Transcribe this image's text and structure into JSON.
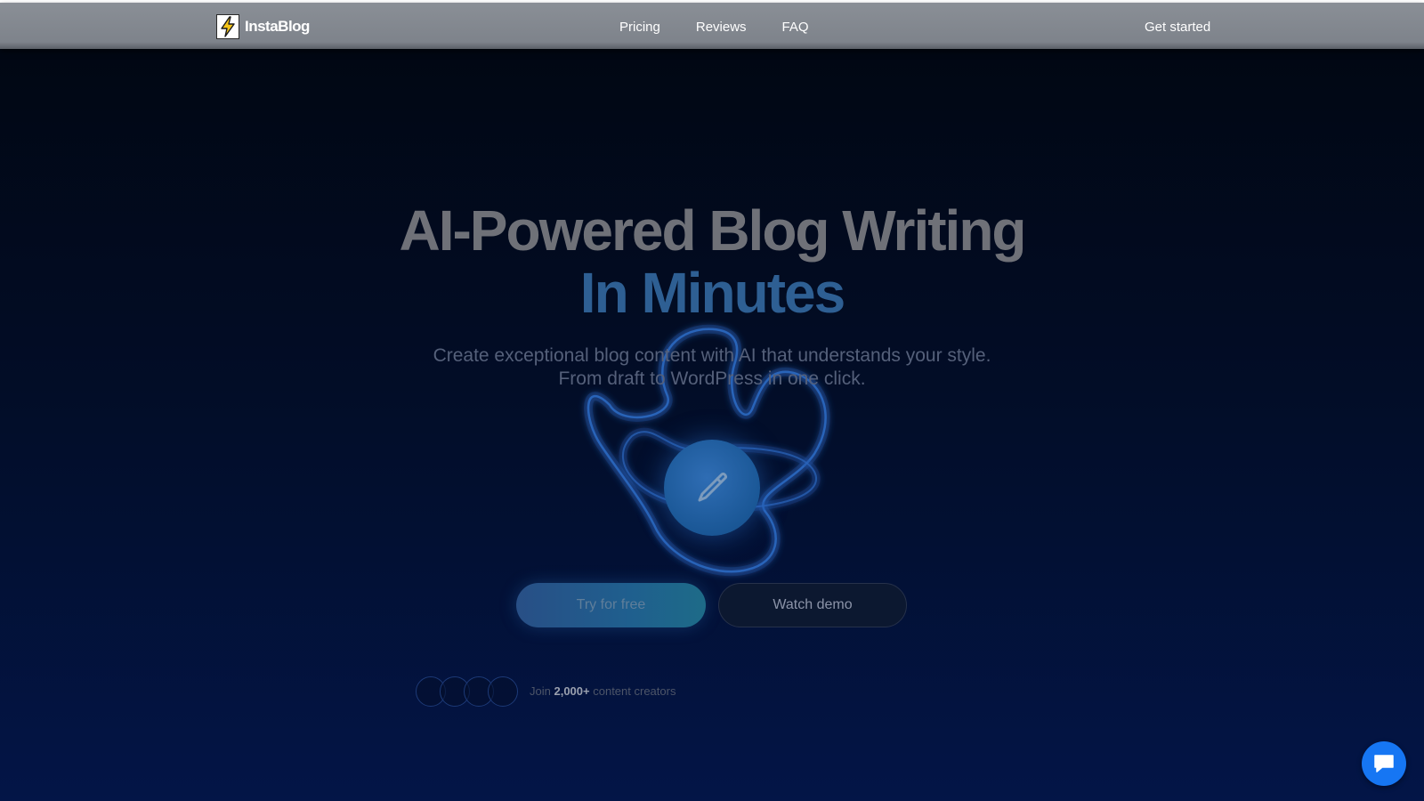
{
  "nav": {
    "logo_text": "InstaBlog",
    "links": [
      "Pricing",
      "Reviews",
      "FAQ"
    ],
    "cta": "Get started"
  },
  "hero": {
    "headline": "AI-Powered Blog Writing",
    "headline_accent": "In Minutes",
    "subline_1": "Create exceptional blog content with AI that understands your style.",
    "subline_2": "From draft to WordPress in one click.",
    "primary_button": "Try for free",
    "secondary_button": "Watch demo",
    "social_proof": {
      "prefix": "Join",
      "count": "2,000+",
      "suffix": "content creators"
    }
  },
  "icons": {
    "logo": "lightning-bolt-icon",
    "hero": "pencil-icon",
    "chat": "chat-bubble-icon"
  },
  "colors": {
    "accent": "#1676f3",
    "logo_bolt": "#f5c518"
  }
}
